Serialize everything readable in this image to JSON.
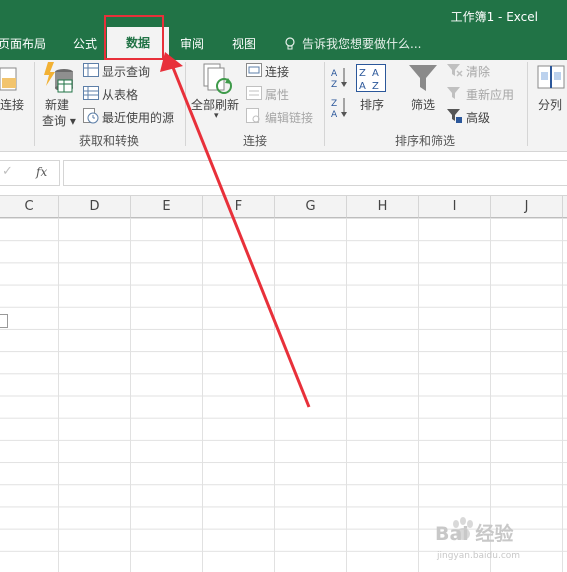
{
  "window": {
    "title": "工作簿1 - Excel"
  },
  "tabs": [
    {
      "label": "页面布局"
    },
    {
      "label": "公式"
    },
    {
      "label": "数据",
      "active": true
    },
    {
      "label": "审阅"
    },
    {
      "label": "视图"
    }
  ],
  "tell_me": {
    "placeholder": "告诉我您想要做什么..."
  },
  "ribbon": {
    "connections_left": {
      "label": "连接"
    },
    "get_transform": {
      "new_query": "新建",
      "new_query_line2": "查询",
      "show_queries": "显示查询",
      "from_table": "从表格",
      "recent_sources": "最近使用的源",
      "group_label": "获取和转换"
    },
    "connections": {
      "refresh_all": "全部刷新",
      "connections": "连接",
      "properties": "属性",
      "edit_links": "编辑链接",
      "group_label": "连接"
    },
    "sort_filter": {
      "sort": "排序",
      "filter": "筛选",
      "clear": "清除",
      "reapply": "重新应用",
      "advanced": "高级",
      "group_label": "排序和筛选"
    },
    "data_tools": {
      "split": "分列"
    }
  },
  "formula_bar": {
    "fx": "fx",
    "check": "✓"
  },
  "columns": [
    "C",
    "D",
    "E",
    "F",
    "G",
    "H",
    "I",
    "J"
  ],
  "watermark": {
    "text": "Bai 经验",
    "sub": "jingyan.baidu.com"
  },
  "colors": {
    "accent": "#217346",
    "annotation": "#e8303a"
  }
}
